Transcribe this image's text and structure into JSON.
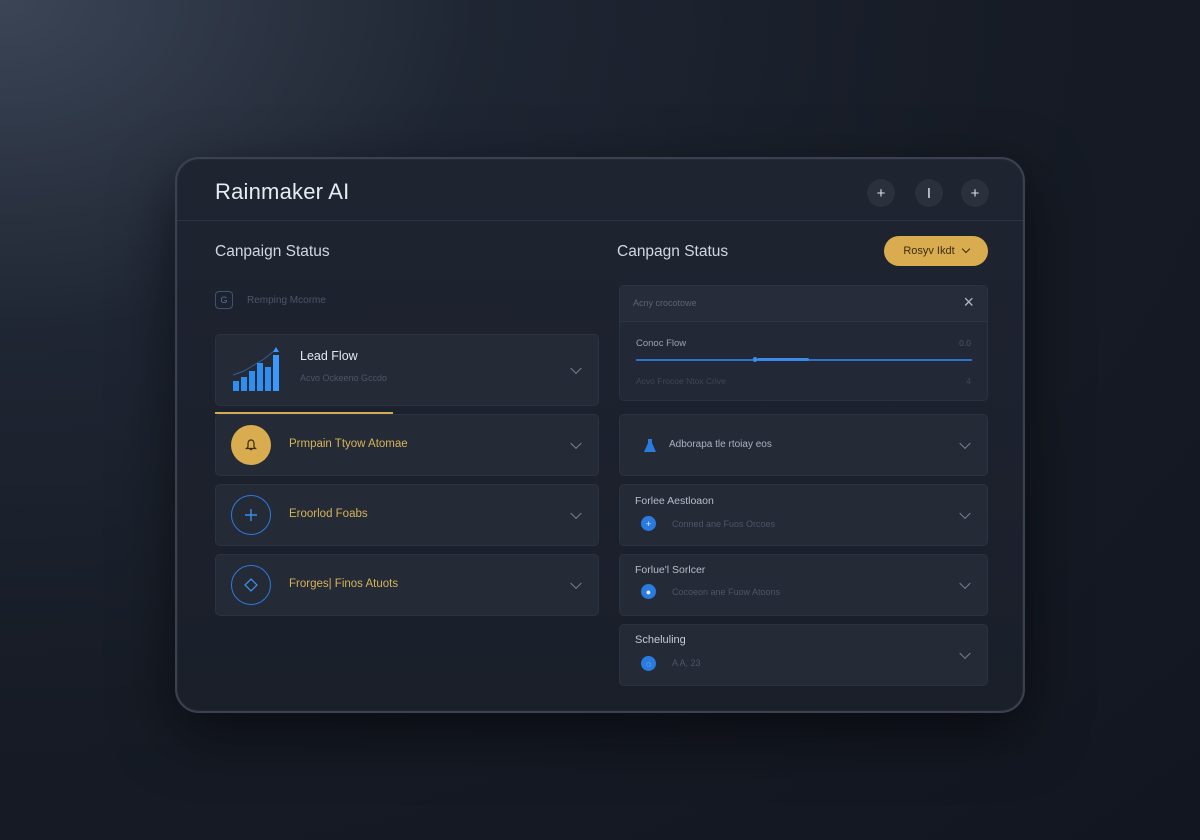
{
  "app": {
    "title": "Rainmaker AI"
  },
  "window_controls": [
    "+",
    "I",
    "+"
  ],
  "left": {
    "title": "Canpaign Status",
    "search_placeholder": "Remping Mcorme",
    "search_icon_glyph": "G",
    "cards": [
      {
        "label": "Lead Flow",
        "sub": "Acvo Ockeeno Gccdo"
      },
      {
        "label": "Prmpain Ttyow Atomae"
      },
      {
        "label": "Eroorlod Foabs"
      },
      {
        "label": "Frorges| Finos Atuots"
      }
    ],
    "lead_flow_progress": 0.47
  },
  "right": {
    "title": "Canpagn Status",
    "action_button": "Rosyv Ikdt",
    "panel": {
      "header": "Acny crocotowe",
      "close": "×",
      "slider_label": "Conoc Flow",
      "slider_value": "0.0",
      "slider_level": 0.44,
      "sub_label": "Acvo Frocoe Ntox Crive",
      "sub_value": "4"
    },
    "rows": [
      {
        "label": "Adborapa tle rtoiay eos"
      },
      {
        "title": "Forlee Aestloaon",
        "sub": "Conned ane Fuos Orcoes"
      },
      {
        "title": "Forlue'l Sorlcer",
        "sub": "Cocoeon ane Fuow Atoons"
      },
      {
        "title": "Scheluling",
        "sub": "A A, 23"
      }
    ]
  },
  "colors": {
    "accent_gold": "#d9ad4f",
    "accent_blue": "#2a7be0",
    "background": "#161b25"
  },
  "icons": [
    "plus-icon",
    "bar-chart-icon",
    "bell-icon",
    "plus-circle-icon",
    "diamond-icon",
    "close-icon",
    "flask-icon"
  ]
}
